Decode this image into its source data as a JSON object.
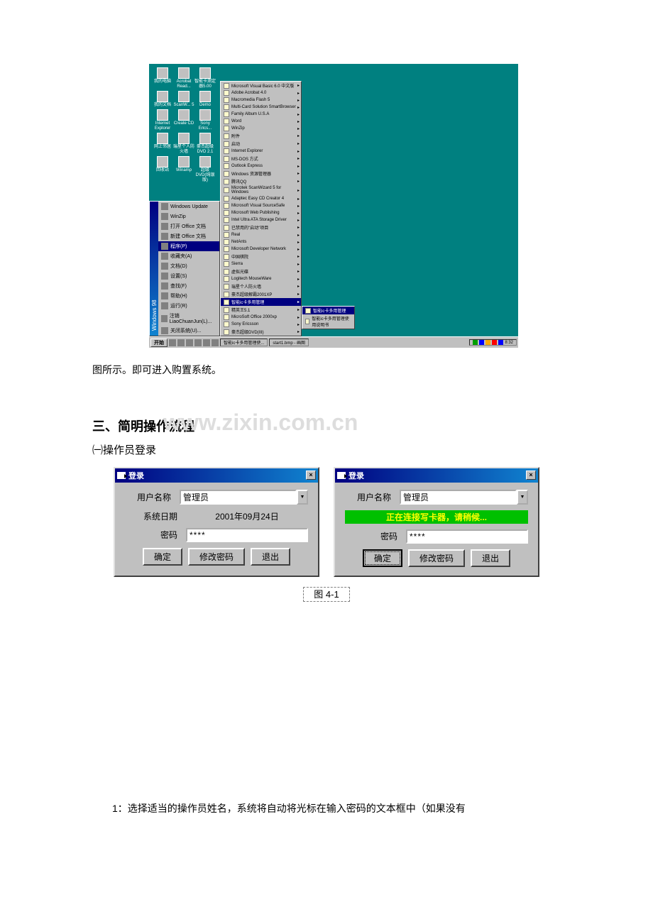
{
  "desktop_icons": [
    {
      "label": "我的电脑"
    },
    {
      "label": "Acrobat Read..."
    },
    {
      "label": "智能卡测定器5.00"
    },
    {
      "label": "我的文档"
    },
    {
      "label": "ScanW... 5"
    },
    {
      "label": "Demo"
    },
    {
      "label": "Internet Explorer"
    },
    {
      "label": "Create CD"
    },
    {
      "label": "Sony Erics..."
    },
    {
      "label": "网上邻居"
    },
    {
      "label": "瑞星个人防火墙"
    },
    {
      "label": "豪杰超级 DVD 2.1"
    },
    {
      "label": "回收站"
    },
    {
      "label": "Winamp"
    },
    {
      "label": "超级DVD(纯银版)"
    }
  ],
  "start_side": "Windows 98",
  "start_items": [
    "Windows Update",
    "WinZip",
    "打开 Office 文档",
    "新建 Office 文档",
    "程序(P)",
    "收藏夹(A)",
    "文档(D)",
    "设置(S)",
    "查找(F)",
    "帮助(H)",
    "运行(R)",
    "注销 LiaoChuanJun(L)...",
    "关闭系统(U)..."
  ],
  "start_highlight_index": 4,
  "submenu": [
    "Microsoft Visual Basic 6.0 中文版",
    "Adobe Acrobat 4.0",
    "Macromedia Flash 5",
    "Multi-Card Solution SmartBrowser",
    "Family Album U.S.A",
    "Word",
    "WinZip",
    "附件",
    "启动",
    "Internet Explorer",
    "MS-DOS 方式",
    "Outlook Express",
    "Windows 资源管理器",
    "腾讯QQ",
    "Microtek ScanWizard 5 for Windows",
    "Adaptec Easy CD Creator 4",
    "Microsoft Visual SourceSafe",
    "Microsoft Web Publishing",
    "Intel Ultra ATA Storage Driver",
    "已禁用的\"启动\"项目",
    "Real",
    "NetAnts",
    "Microsoft Developer Network",
    "中国棋院",
    "Sierra",
    "虚拟光碟",
    "Logitech MouseWare",
    "瑞星个人防火墙",
    "豪杰超级解霸2001XP",
    "智能ic卡多用管理",
    "精英王5.1",
    "MicroSoft Office 2000xp",
    "Sony Ericsson",
    "豪杰超级DVD(III)"
  ],
  "submenu_highlight_index": 29,
  "flyout": [
    "智能ic卡多用管理",
    "智能ic卡多用管理使用说明书"
  ],
  "flyout_highlight_index": 0,
  "taskbar": {
    "start": "开始",
    "tasks": [
      "智能ic卡多用管理使...",
      "start1.bmp - 画图"
    ],
    "time": "8:32"
  },
  "text_after": "图所示。即可进入购置系统。",
  "h2": "三、简明操作流程",
  "h3": "㈠操作员登录",
  "dialog": {
    "title": "登录",
    "labels": {
      "user": "用户名称",
      "date": "系统日期",
      "pwd": "密码"
    },
    "user_value": "管理员",
    "date_value": "2001年09月24日",
    "pwd_value": "****",
    "status": "正在连接写卡器，请稍候...",
    "btn_ok": "确定",
    "btn_chpwd": "修改密码",
    "btn_exit": "退出"
  },
  "figcap": "图 4-1",
  "footer": "1：选择适当的操作员姓名，系统将自动将光标在输入密码的文本框中（如果没有"
}
